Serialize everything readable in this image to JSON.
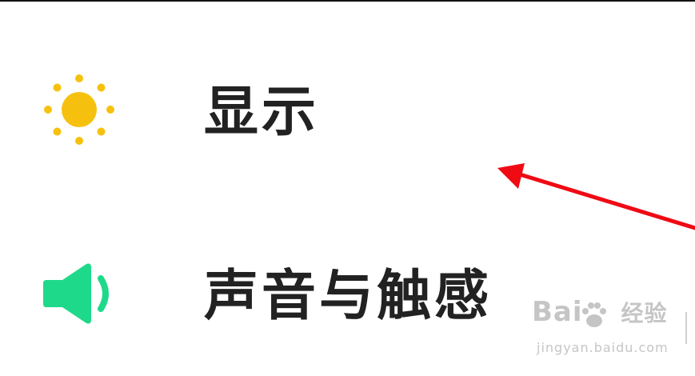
{
  "settings": {
    "items": [
      {
        "label": "显示",
        "icon": "sun-icon",
        "icon_color": "#F6C10E"
      },
      {
        "label": "声音与触感",
        "icon": "speaker-icon",
        "icon_color": "#1FD98A"
      }
    ]
  },
  "annotation": {
    "arrow_color": "#F00A14"
  },
  "watermark": {
    "brand_left": "Bai",
    "brand_right": "经验",
    "url": "jingyan.baidu.com"
  }
}
